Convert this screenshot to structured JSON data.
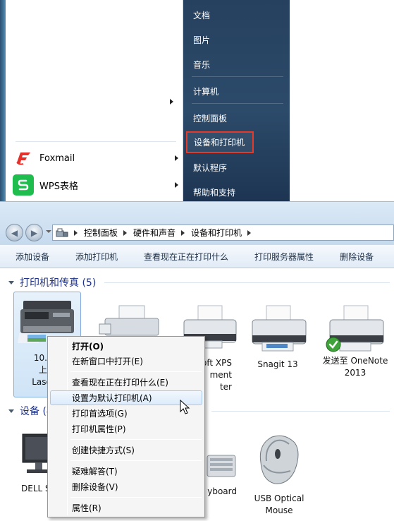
{
  "start_menu": {
    "programs": [
      {
        "name": "Foxmail",
        "icon": "foxmail-icon"
      },
      {
        "name": "WPS表格",
        "icon": "wps-spreadsheet-icon"
      }
    ],
    "right_items": [
      {
        "label": "文档"
      },
      {
        "label": "图片"
      },
      {
        "label": "音乐"
      },
      {
        "label": "计算机"
      },
      {
        "label": "控制面板"
      },
      {
        "label": "设备和打印机",
        "highlighted": true
      },
      {
        "label": "默认程序"
      },
      {
        "label": "帮助和支持"
      }
    ]
  },
  "explorer": {
    "breadcrumb": [
      "控制面板",
      "硬件和声音",
      "设备和打印机"
    ],
    "toolbar": [
      "添加设备",
      "添加打印机",
      "查看现在正在打印什么",
      "打印服务器属性",
      "删除设备"
    ],
    "groups": {
      "printers": "打印机和传真 (5)",
      "devices": "设备 (4"
    },
    "printers": [
      {
        "line1": "10.13.",
        "line2": "上的",
        "line3": "LaserJe",
        "icon": "multifunction-printer-icon",
        "selected": true
      },
      {
        "line1": "oft XPS",
        "line2": "ment",
        "line3": "ter",
        "icon": "printer-icon"
      },
      {
        "line1": "Snagit 13",
        "line2": "",
        "line3": "",
        "icon": "printer-icon"
      },
      {
        "line1": "发送至 OneNote",
        "line2": "2013",
        "line3": "",
        "icon": "default-printer-icon",
        "default": true
      }
    ],
    "devices": [
      {
        "line1": "DELL S",
        "line2": "",
        "icon": "monitor-icon"
      },
      {
        "line1": "yboard",
        "line2": "",
        "icon": "keyboard-icon"
      },
      {
        "line1": "USB Optical",
        "line2": "Mouse",
        "icon": "mouse-icon"
      }
    ]
  },
  "context_menu": {
    "items": [
      {
        "label": "打开(O)",
        "bold": true
      },
      {
        "label": "在新窗口中打开(E)"
      },
      {
        "label": "查看现在正在打印什么(E)"
      },
      {
        "label": "设置为默认打印机(A)",
        "highlighted": true
      },
      {
        "label": "打印首选项(G)"
      },
      {
        "label": "打印机属性(P)"
      },
      {
        "label": "创建快捷方式(S)"
      },
      {
        "label": "疑难解答(T)"
      },
      {
        "label": "删除设备(V)"
      },
      {
        "label": "属性(R)"
      }
    ]
  },
  "colors": {
    "start_right_bg": "#2c4a6a",
    "highlight_border": "#e43a2a",
    "group_header": "#1e3287"
  }
}
